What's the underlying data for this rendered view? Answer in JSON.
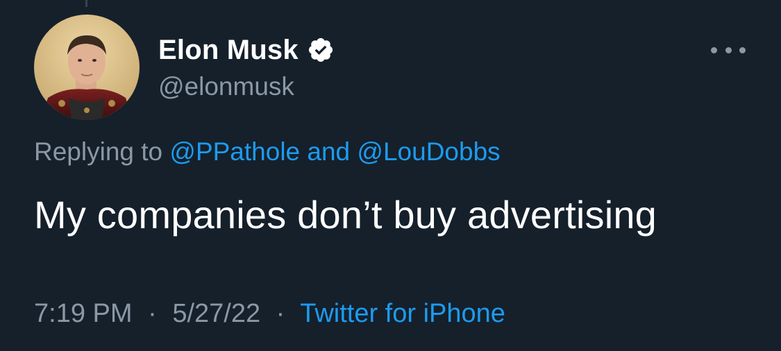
{
  "tweet": {
    "author": {
      "display_name": "Elon Musk",
      "handle": "@elonmusk",
      "verified": true,
      "avatar_icon": "profile-photo"
    },
    "reply_context": {
      "prefix": "Replying to",
      "users": [
        "@PPathole",
        "@LouDobbs"
      ],
      "joiner": "and"
    },
    "text": "My companies don’t buy advertising",
    "meta": {
      "time": "7:19 PM",
      "date": "5/27/22",
      "separator": "·",
      "source": "Twitter for iPhone"
    },
    "more_icon": "more-horizontal-icon"
  },
  "colors": {
    "background": "#15202b",
    "primary_text": "#ffffff",
    "secondary_text": "#8b98a5",
    "link": "#1d9bf0",
    "verified_badge": "#ffffff"
  }
}
